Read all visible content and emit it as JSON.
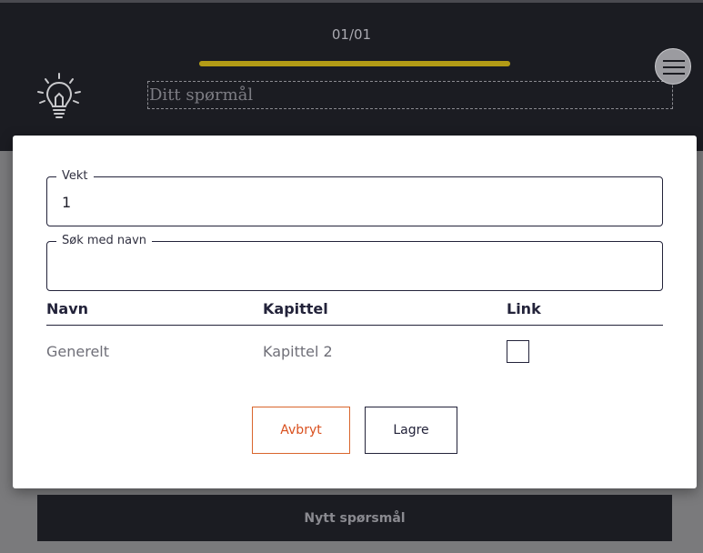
{
  "header": {
    "counter": "01/01",
    "progress": 1.0,
    "question_placeholder": "Ditt spørmål",
    "bulb_icon": "lightbulb-icon",
    "menu_icon": "hamburger-menu-icon"
  },
  "modal": {
    "weight_field": {
      "label": "Vekt",
      "value": "1"
    },
    "search_field": {
      "label": "Søk med navn",
      "value": ""
    },
    "table": {
      "columns": [
        "Navn",
        "Kapittel",
        "Link"
      ],
      "rows": [
        {
          "name": "Generelt",
          "chapter": "Kapittel 2",
          "link_checked": false
        }
      ]
    },
    "cancel_label": "Avbryt",
    "save_label": "Lagre"
  },
  "footer": {
    "new_question_label": "Nytt spørsmål"
  },
  "colors": {
    "dark": "#1b1c22",
    "accent_progress": "#b39b16",
    "cancel": "#d9501e",
    "overlay": "#7a7a7c"
  }
}
